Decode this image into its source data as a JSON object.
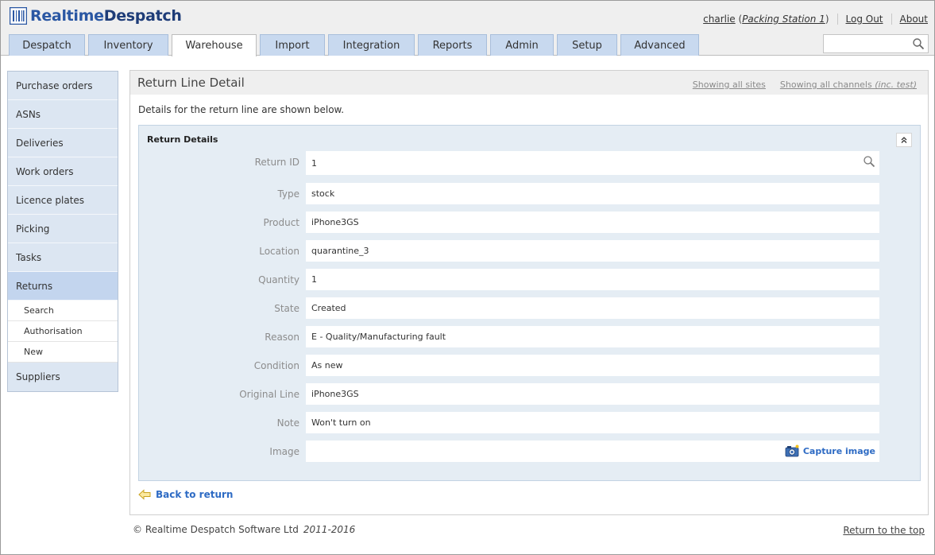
{
  "app": {
    "logo_part1": "Realtime",
    "logo_part2": "Despatch"
  },
  "user": {
    "name": "charlie",
    "station": "Packing Station 1",
    "logout": "Log Out",
    "about": "About"
  },
  "tabs": [
    {
      "label": "Despatch",
      "active": false
    },
    {
      "label": "Inventory",
      "active": false
    },
    {
      "label": "Warehouse",
      "active": true
    },
    {
      "label": "Import",
      "active": false
    },
    {
      "label": "Integration",
      "active": false
    },
    {
      "label": "Reports",
      "active": false
    },
    {
      "label": "Admin",
      "active": false
    },
    {
      "label": "Setup",
      "active": false
    },
    {
      "label": "Advanced",
      "active": false
    }
  ],
  "search": {
    "value": ""
  },
  "sidebar": {
    "items": [
      {
        "label": "Purchase orders"
      },
      {
        "label": "ASNs"
      },
      {
        "label": "Deliveries"
      },
      {
        "label": "Work orders"
      },
      {
        "label": "Licence plates"
      },
      {
        "label": "Picking"
      },
      {
        "label": "Tasks"
      },
      {
        "label": "Returns",
        "active": true
      },
      {
        "label": "Suppliers"
      }
    ],
    "returns_subitems": [
      {
        "label": "Search"
      },
      {
        "label": "Authorisation"
      },
      {
        "label": "New"
      }
    ]
  },
  "panel": {
    "title": "Return Line Detail",
    "scope_sites": "Showing all sites",
    "scope_channels": "Showing all channels",
    "scope_channels_note": "(inc. test)",
    "intro": "Details for the return line are shown below.",
    "fieldset_title": "Return Details",
    "collapse_icon": "double-chevron-up",
    "fields": {
      "return_id": {
        "label": "Return ID",
        "value": "1"
      },
      "type": {
        "label": "Type",
        "value": "stock"
      },
      "product": {
        "label": "Product",
        "value": "iPhone3GS"
      },
      "location": {
        "label": "Location",
        "value": "quarantine_3"
      },
      "quantity": {
        "label": "Quantity",
        "value": "1"
      },
      "state": {
        "label": "State",
        "value": "Created"
      },
      "reason": {
        "label": "Reason",
        "value": "E - Quality/Manufacturing fault"
      },
      "condition": {
        "label": "Condition",
        "value": "As new"
      },
      "original_line": {
        "label": "Original Line",
        "value": "iPhone3GS"
      },
      "note": {
        "label": "Note",
        "value": "Won't turn on"
      },
      "image": {
        "label": "Image",
        "value": "",
        "action": "Capture image"
      }
    },
    "back_link": "Back to return"
  },
  "footer": {
    "copyright": "© Realtime Despatch Software Ltd",
    "years": "2011-2016",
    "top_link": "Return to the top"
  },
  "colors": {
    "brand_blue": "#2a57a3",
    "tab_bg": "#c8d9ef",
    "link_blue": "#2e6bc4",
    "fieldset_bg": "#e5edf4"
  }
}
